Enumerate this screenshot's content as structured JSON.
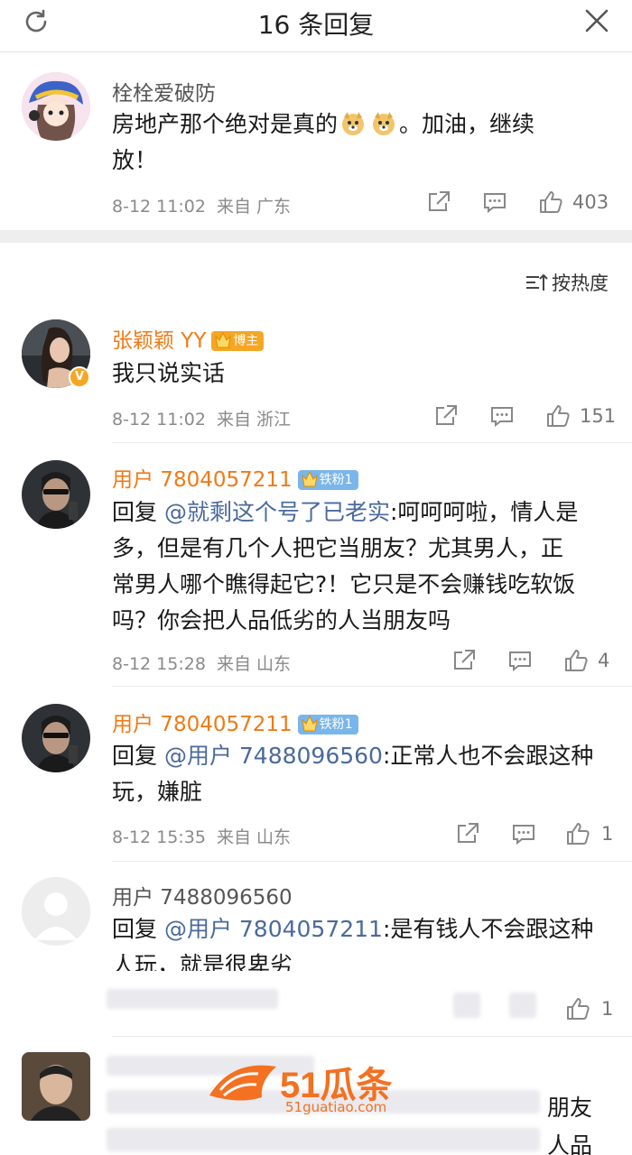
{
  "header": {
    "title": "16 条回复"
  },
  "root": {
    "name": "栓栓爱破防",
    "text_1": "房地产那个绝对是真的",
    "text_2": "。加油，继续",
    "text_3": "放！",
    "time": "8-12 11:02",
    "source": "来自 广东",
    "likes": "403"
  },
  "sort": {
    "label": "按热度"
  },
  "replies": [
    {
      "name": "张颖颖 YY",
      "badge": "博主",
      "text": "我只说实话",
      "time": "8-12 11:02",
      "source": "来自 浙江",
      "likes": "151"
    },
    {
      "name": "用户 7804057211",
      "badge": "铁粉1",
      "reply_prefix": "回复 ",
      "mention": "@就剩这个号了已老实",
      "line1": ":呵呵呵啦，情人是",
      "line2": "多，但是有几个人把它当朋友？尤其男人，正",
      "line3": "常男人哪个瞧得起它?！它只是不会赚钱吃软饭",
      "line4": "吗？你会把人品低劣的人当朋友吗",
      "time": "8-12 15:28",
      "source": "来自 山东",
      "likes": "4"
    },
    {
      "name": "用户 7804057211",
      "badge": "铁粉1",
      "reply_prefix": "回复 ",
      "mention": "@用户 7488096560",
      "line1": ":正常人也不会跟这种",
      "line2": "玩，嫌脏",
      "time": "8-12 15:35",
      "source": "来自 山东",
      "likes": "1"
    },
    {
      "name": "用户 7488096560",
      "reply_prefix": "回复 ",
      "mention": "@用户 7804057211",
      "line1": ":是有钱人不会跟这种",
      "line2": "人玩，就是很卑劣",
      "likes": "1"
    }
  ],
  "partial": {
    "text_a": "朋友",
    "text_b": "人品"
  },
  "watermark": {
    "brand": "51瓜条",
    "url": "51guatiao.com"
  },
  "colors": {
    "accent_orange": "#f07a16",
    "mention_blue": "#4a6a9c",
    "blogger_badge": "#f5a623",
    "fan_badge": "#7ab6ea"
  },
  "icons": [
    "refresh-icon",
    "close-icon",
    "share-icon",
    "comment-icon",
    "like-icon",
    "sort-icon",
    "crown-icon",
    "verified-icon"
  ]
}
